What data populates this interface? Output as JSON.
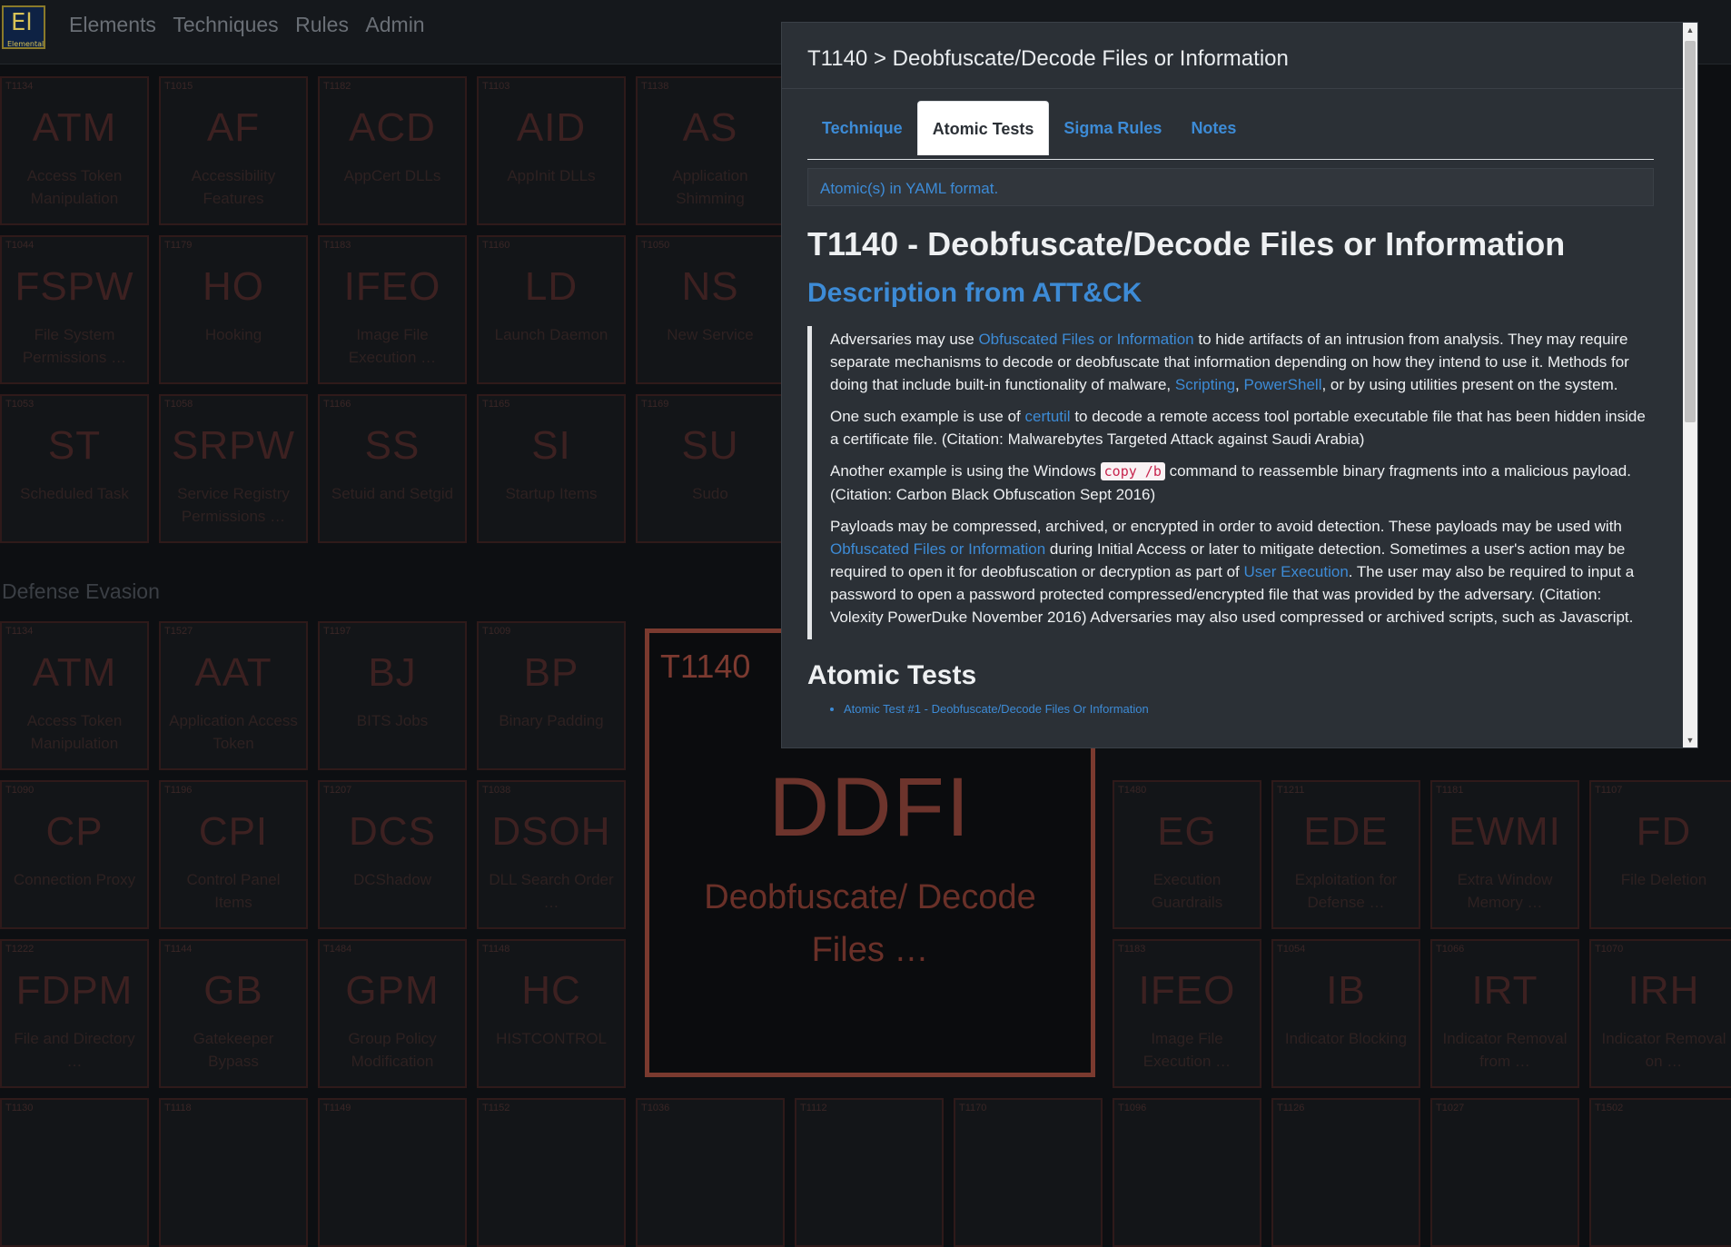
{
  "nav": {
    "logo": {
      "symbol": "El",
      "name": "Elemental"
    },
    "links": [
      "Elements",
      "Techniques",
      "Rules",
      "Admin"
    ]
  },
  "grid": {
    "section_label": "Defense Evasion",
    "tiles": [
      {
        "id": "T1134",
        "sym": "ATM",
        "name": "Access Token Manipulation"
      },
      {
        "id": "T1015",
        "sym": "AF",
        "name": "Accessibility Features"
      },
      {
        "id": "T1182",
        "sym": "ACD",
        "name": "AppCert DLLs"
      },
      {
        "id": "T1103",
        "sym": "AID",
        "name": "AppInit DLLs"
      },
      {
        "id": "T1138",
        "sym": "AS",
        "name": "Application Shimming"
      },
      {
        "id": "T1044",
        "sym": "FSPW",
        "name": "File System Permissions …"
      },
      {
        "id": "T1179",
        "sym": "HO",
        "name": "Hooking"
      },
      {
        "id": "T1183",
        "sym": "IFEO",
        "name": "Image File Execution …"
      },
      {
        "id": "T1160",
        "sym": "LD",
        "name": "Launch Daemon"
      },
      {
        "id": "T1050",
        "sym": "NS",
        "name": "New Service"
      },
      {
        "id": "T1053",
        "sym": "ST",
        "name": "Scheduled Task"
      },
      {
        "id": "T1058",
        "sym": "SRPW",
        "name": "Service Registry Permissions …"
      },
      {
        "id": "T1166",
        "sym": "SS",
        "name": "Setuid and Setgid"
      },
      {
        "id": "T1165",
        "sym": "SI",
        "name": "Startup Items"
      },
      {
        "id": "T1169",
        "sym": "SU",
        "name": "Sudo"
      },
      {
        "id": "T1134",
        "sym": "ATM",
        "name": "Access Token Manipulation"
      },
      {
        "id": "T1527",
        "sym": "AAT",
        "name": "Application Access Token"
      },
      {
        "id": "T1197",
        "sym": "BJ",
        "name": "BITS Jobs"
      },
      {
        "id": "T1009",
        "sym": "BP",
        "name": "Binary Padding"
      },
      {
        "id": "T1090",
        "sym": "CP",
        "name": "Connection Proxy"
      },
      {
        "id": "T1196",
        "sym": "CPI",
        "name": "Control Panel Items"
      },
      {
        "id": "T1207",
        "sym": "DCS",
        "name": "DCShadow"
      },
      {
        "id": "T1038",
        "sym": "DSOH",
        "name": "DLL Search Order …"
      },
      {
        "id": "T1480",
        "sym": "EG",
        "name": "Execution Guardrails"
      },
      {
        "id": "T1211",
        "sym": "EDE",
        "name": "Exploitation for Defense …"
      },
      {
        "id": "T1181",
        "sym": "EWMI",
        "name": "Extra Window Memory …"
      },
      {
        "id": "T1107",
        "sym": "FD",
        "name": "File Deletion"
      },
      {
        "id": "T1222",
        "sym": "FDPM",
        "name": "File and Directory …"
      },
      {
        "id": "T1144",
        "sym": "GB",
        "name": "Gatekeeper Bypass"
      },
      {
        "id": "T1484",
        "sym": "GPM",
        "name": "Group Policy Modification"
      },
      {
        "id": "T1148",
        "sym": "HC",
        "name": "HISTCONTROL"
      },
      {
        "id": "T1183",
        "sym": "IFEO",
        "name": "Image File Execution …"
      },
      {
        "id": "T1054",
        "sym": "IB",
        "name": "Indicator Blocking"
      },
      {
        "id": "T1066",
        "sym": "IRT",
        "name": "Indicator Removal from …"
      },
      {
        "id": "T1070",
        "sym": "IRH",
        "name": "Indicator Removal on …"
      },
      {
        "id": "T1130",
        "sym": "",
        "name": ""
      },
      {
        "id": "T1118",
        "sym": "",
        "name": ""
      },
      {
        "id": "T1149",
        "sym": "",
        "name": ""
      },
      {
        "id": "T1152",
        "sym": "",
        "name": ""
      },
      {
        "id": "T1036",
        "sym": "",
        "name": ""
      },
      {
        "id": "T1112",
        "sym": "",
        "name": ""
      },
      {
        "id": "T1170",
        "sym": "",
        "name": ""
      },
      {
        "id": "T1096",
        "sym": "",
        "name": ""
      },
      {
        "id": "T1126",
        "sym": "",
        "name": ""
      },
      {
        "id": "T1027",
        "sym": "",
        "name": ""
      },
      {
        "id": "T1502",
        "sym": "",
        "name": ""
      }
    ],
    "selected": {
      "id": "T1140",
      "sym": "DDFI",
      "name": "Deobfuscate/ Decode Files …"
    }
  },
  "modal": {
    "title": "T1140 > Deobfuscate/Decode Files or Information",
    "tabs": [
      {
        "label": "Technique",
        "active": false
      },
      {
        "label": "Atomic Tests",
        "active": true
      },
      {
        "label": "Sigma Rules",
        "active": false
      },
      {
        "label": "Notes",
        "active": false
      }
    ],
    "info": "Atomic(s) in YAML format.",
    "heading": "T1140 - Deobfuscate/Decode Files or Information",
    "subheading": "Description from ATT&CK",
    "p1": {
      "a": "Adversaries may use ",
      "link1": "Obfuscated Files or Information",
      "b": " to hide artifacts of an intrusion from analysis. They may require separate mechanisms to decode or deobfuscate that information depending on how they intend to use it. Methods for doing that include built-in functionality of malware, ",
      "link2": "Scripting",
      "c": ", ",
      "link3": "PowerShell",
      "d": ", or by using utilities present on the system."
    },
    "p2": {
      "a": "One such example is use of ",
      "link1": "certutil",
      "b": " to decode a remote access tool portable executable file that has been hidden inside a certificate file. (Citation: Malwarebytes Targeted Attack against Saudi Arabia)"
    },
    "p3": {
      "a": "Another example is using the Windows ",
      "code": "copy /b",
      "b": " command to reassemble binary fragments into a malicious payload. (Citation: Carbon Black Obfuscation Sept 2016)"
    },
    "p4": {
      "a": "Payloads may be compressed, archived, or encrypted in order to avoid detection. These payloads may be used with ",
      "link1": "Obfuscated Files or Information",
      "b": " during Initial Access or later to mitigate detection. Sometimes a user's action may be required to open it for deobfuscation or decryption as part of ",
      "link2": "User Execution",
      "c": ". The user may also be required to input a password to open a password protected compressed/encrypted file that was provided by the adversary. (Citation: Volexity PowerDuke November 2016) Adversaries may also used compressed or archived scripts, such as Javascript."
    },
    "atomic_heading": "Atomic Tests",
    "atomic_items": [
      "Atomic Test #1 - Deobfuscate/Decode Files Or Information"
    ]
  }
}
